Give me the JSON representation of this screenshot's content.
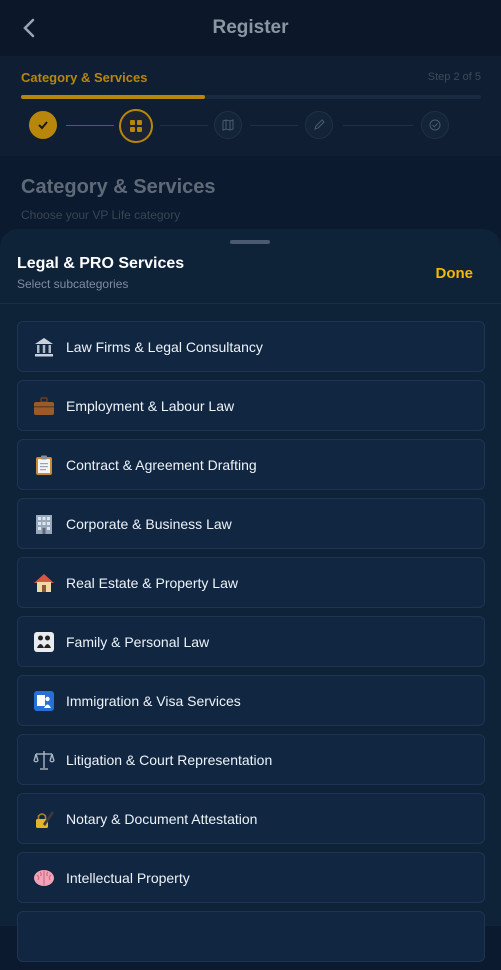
{
  "header": {
    "title": "Register",
    "back_icon": "chevron-left-icon"
  },
  "stepper": {
    "label": "Category & Services",
    "step_text": "Step 2 of 5",
    "progress": 0.4,
    "accent": "#b8860b",
    "nodes": [
      "check-icon",
      "grid-icon",
      "map-icon",
      "pencil-icon",
      "check-circle-icon"
    ]
  },
  "page": {
    "heading": "Category & Services",
    "subtitle": "Choose your VP Life category"
  },
  "sheet": {
    "title": "Legal & PRO Services",
    "subtitle": "Select subcategories",
    "done_label": "Done",
    "items": [
      {
        "label": "Law Firms & Legal Consultancy",
        "icon": "classical-building-icon"
      },
      {
        "label": "Employment & Labour Law",
        "icon": "briefcase-icon"
      },
      {
        "label": "Contract & Agreement Drafting",
        "icon": "clipboard-icon"
      },
      {
        "label": "Corporate & Business Law",
        "icon": "office-building-icon"
      },
      {
        "label": "Real Estate & Property Law",
        "icon": "house-icon"
      },
      {
        "label": "Family & Personal Law",
        "icon": "family-icon"
      },
      {
        "label": "Immigration & Visa Services",
        "icon": "passport-control-icon"
      },
      {
        "label": "Litigation & Court Representation",
        "icon": "balance-scale-icon"
      },
      {
        "label": "Notary & Document Attestation",
        "icon": "pen-lock-icon"
      },
      {
        "label": "Intellectual Property",
        "icon": "brain-icon"
      }
    ]
  }
}
